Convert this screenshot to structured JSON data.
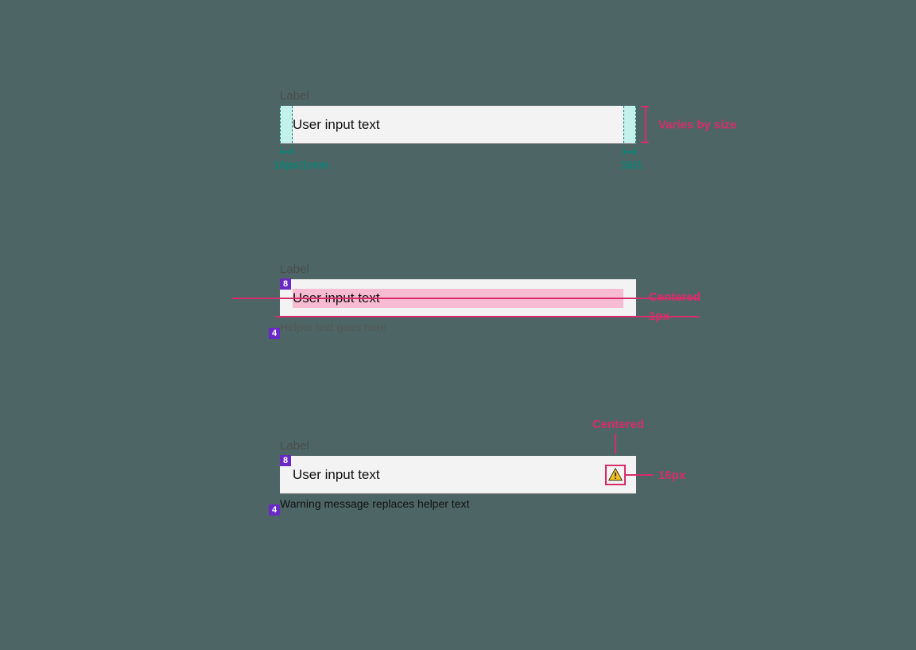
{
  "colors": {
    "background": "#4d6665",
    "pad_highlight": "#c5f1ec",
    "pad_dash": "#007d79",
    "dim_teal": "#0e8074",
    "dim_pink": "#d62e6b",
    "pink_fill": "#f7bcd1",
    "purple": "#6929c4",
    "field_bg": "#f3f3f3"
  },
  "spec1": {
    "label": "Label",
    "input_text": "User input text",
    "padding_left_label": "16px/1rem",
    "padding_right_label": "16/1",
    "height_label": "Varies by size"
  },
  "spec2": {
    "label": "Label",
    "input_text": "User input text",
    "helper_text": "Helper text goes here",
    "badge_top": "8",
    "badge_bottom": "4",
    "anno_centered": "Centered",
    "anno_border": "1px"
  },
  "spec3": {
    "label": "Label",
    "input_text": "User input text",
    "warning_text": "Warning message replaces helper text",
    "badge_top": "8",
    "badge_bottom": "4",
    "anno_centered": "Centered",
    "anno_icon_size": "16px"
  }
}
